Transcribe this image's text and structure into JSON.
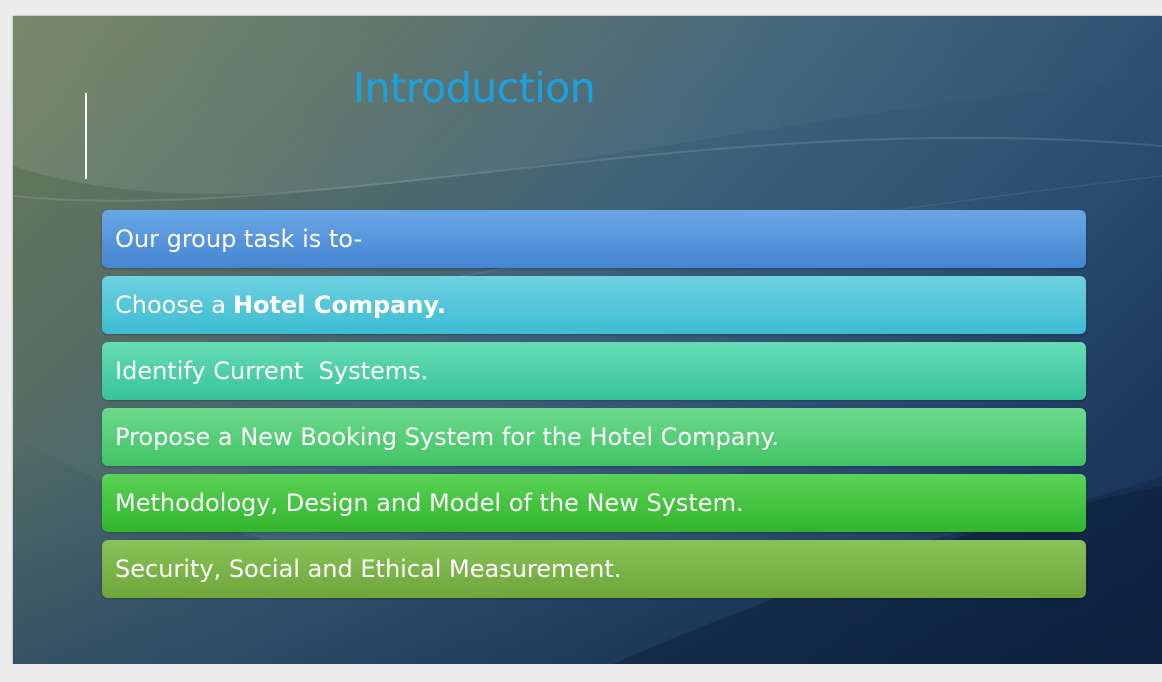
{
  "slide": {
    "title": "Introduction",
    "items": [
      {
        "text": "Our group task is to-",
        "bold": ""
      },
      {
        "text": "Choose a",
        "bold": "Hotel Company."
      },
      {
        "text": "Identify Current  Systems.",
        "bold": ""
      },
      {
        "text": "Propose a New Booking System for the Hotel Company.",
        "bold": ""
      },
      {
        "text": "Methodology, Design and Model of the New System.",
        "bold": ""
      },
      {
        "text": "Security, Social and Ethical Measurement.",
        "bold": ""
      }
    ],
    "colors": {
      "title": "#1aa3e0",
      "item_1": "#4586d3",
      "item_2": "#3ebcd3",
      "item_3": "#38c39a",
      "item_4": "#41c465",
      "item_5": "#32b52d",
      "item_6": "#6ea63a"
    }
  }
}
